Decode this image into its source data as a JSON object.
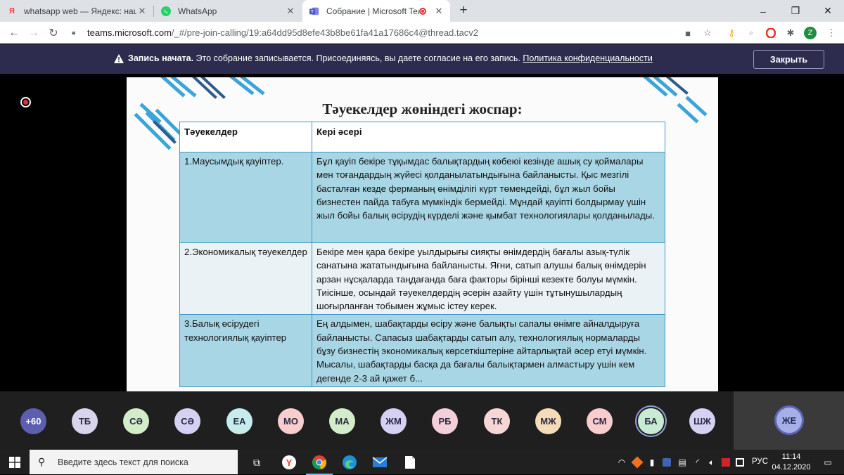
{
  "browser": {
    "tabs": [
      {
        "title": "whatsapp web — Яндекс: нашлось",
        "icon": "yandex-icon"
      },
      {
        "title": "WhatsApp",
        "icon": "whatsapp-icon"
      },
      {
        "title": "Собрание | Microsoft Teams",
        "icon": "teams-icon",
        "active": true
      }
    ],
    "url_host": "teams.microsoft.com",
    "url_rest": "/_#/pre-join-calling/19:a64dd95d8efe43b8be61fa41a17686c4@thread.tacv2",
    "profile_initial": "Z"
  },
  "banner": {
    "bold": "Запись начата.",
    "text": " Это собрание записывается. Присоединяясь, вы даете согласие на его запись. ",
    "link": "Политика конфиденциальности",
    "close_label": "Закрыть"
  },
  "slide": {
    "title": "Тәуекелдер жөніндегі жоспар:",
    "headers": [
      "Тәуекелдер",
      "Кері әсері"
    ],
    "rows": [
      {
        "risk": "1.Маусымдық қауіптер.",
        "effect": "Бұл қауіп бекіре тұқымдас балықтардың көбеюі кезінде ашық су қоймалары мен тоғандардың жүйесі қолданылатындығына байланысты. Қыс мезгілі басталған кезде ферманың өнімділігі күрт төмендейді, бұл жыл бойы бизнестен пайда табуға мүмкіндік бермейді. Мұндай қауіпті болдырмау үшін жыл бойы балық өсірудің күрделі және қымбат технологиялары қолданылады."
      },
      {
        "risk": "2.Экономикалық тәуекелдер",
        "effect": "Бекіре мен қара бекіре уылдырығы сияқты өнімдердің бағалы азық-түлік санатына жататындығына байланысты. Яғни, сатып алушы балық өнімдерін арзан нұсқаларда таңдағанда баға факторы бірінші кезекте болуы мүмкін. Тиісінше, осындай тәуекелдердің әсерін азайту үшін тұтынушылардың шоғырланған тобымен жұмыс істеу керек."
      },
      {
        "risk": "3.Балық өсірудегі технологиялық қауіптер",
        "effect": "Ең алдымен, шабақтарды өсіру және балықты сапалы өнімге айналдыруға байланысты. Сапасыз шабақтарды сатып алу, технологиялық нормаларды бұзу бизнестің экономикалық көрсеткіштеріне айтарлықтай әсер етуі мүмкін. Мысалы, шабақтарды басқа да бағалы балықтармен алмастыру үшін кем дегенде 2-3 ай қажет б..."
      }
    ]
  },
  "participants": {
    "more": "+60",
    "people": [
      {
        "initials": "ТБ",
        "color": "#d9d4ee"
      },
      {
        "initials": "СӘ",
        "color": "#d3ecc9"
      },
      {
        "initials": "СӘ",
        "color": "#d4d1f2"
      },
      {
        "initials": "ЕА",
        "color": "#c7ecec"
      },
      {
        "initials": "МО",
        "color": "#f7cdcd"
      },
      {
        "initials": "МА",
        "color": "#d3ecc9"
      },
      {
        "initials": "ЖМ",
        "color": "#d4d1f2"
      },
      {
        "initials": "РБ",
        "color": "#f3cfd9"
      },
      {
        "initials": "ТК",
        "color": "#f7d6d6"
      },
      {
        "initials": "МЖ",
        "color": "#f5dcb8"
      },
      {
        "initials": "СМ",
        "color": "#f7cdcd"
      },
      {
        "initials": "БА",
        "color": "#c7ecd3",
        "speaking": true
      },
      {
        "initials": "ШЖ",
        "color": "#d4d1f2"
      }
    ],
    "self": "ЖЕ"
  },
  "taskbar": {
    "search_placeholder": "Введите здесь текст для поиска",
    "lang": "РУС",
    "time": "11:14",
    "date": "04.12.2020"
  }
}
